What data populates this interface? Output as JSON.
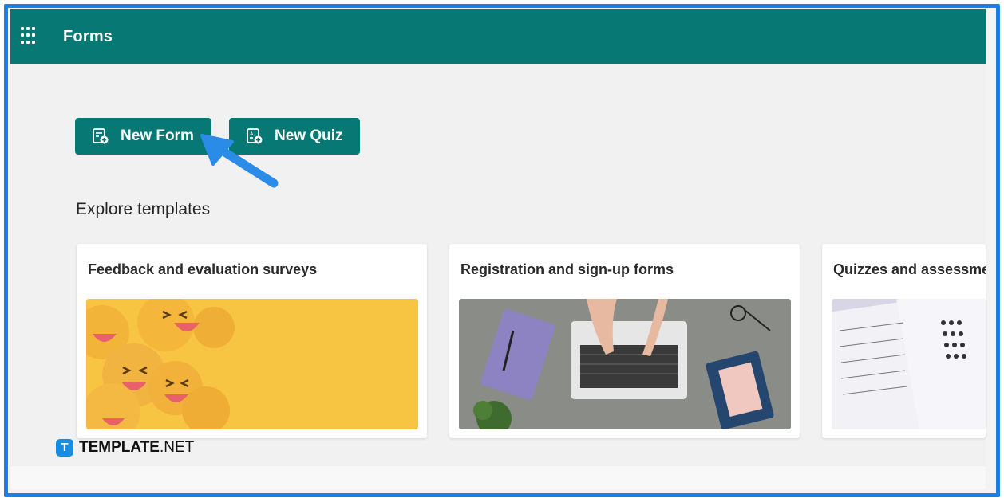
{
  "app": {
    "title": "Forms"
  },
  "actions": {
    "new_form_label": "New Form",
    "new_quiz_label": "New Quiz"
  },
  "templates": {
    "heading": "Explore templates",
    "cards": [
      {
        "title": "Feedback and evaluation surveys"
      },
      {
        "title": "Registration and sign-up forms"
      },
      {
        "title": "Quizzes and assessme"
      }
    ]
  },
  "watermark": {
    "brand": "TEMPLATE",
    "tld": ".NET",
    "badge": "T"
  },
  "colors": {
    "header": "#077873",
    "button": "#077873",
    "frame_border": "#1a7fe6",
    "arrow": "#2a8ce6",
    "yellow": "#f8c542"
  },
  "icons": {
    "app_launcher": "waffle-icon",
    "new_form": "form-add-icon",
    "new_quiz": "quiz-add-icon",
    "pointer": "arrow-pointer-icon"
  }
}
